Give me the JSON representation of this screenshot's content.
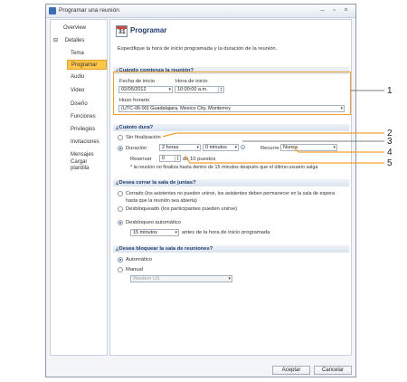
{
  "window": {
    "title": "Programar una reunión"
  },
  "sidebar": {
    "items": [
      {
        "label": "Overview"
      },
      {
        "label": "Detalles"
      },
      {
        "label": "Tema"
      },
      {
        "label": "Programar"
      },
      {
        "label": "Audio"
      },
      {
        "label": "Video"
      },
      {
        "label": "Diseño"
      },
      {
        "label": "Funciones"
      },
      {
        "label": "Privilegios"
      },
      {
        "label": "Invitaciones"
      },
      {
        "label": "Mensajes"
      },
      {
        "label": "Cargar plantilla"
      }
    ],
    "expander": "⊟"
  },
  "page": {
    "icon_number": "31",
    "title": "Programar",
    "description": "Especifique la hora de inicio programada y la duración de la reunión."
  },
  "start": {
    "header": "¿Cuándo comienza la reunión?",
    "date_label": "Fecha de inicio",
    "date_value": "02/05/2012",
    "time_label": "Hora de inicio",
    "time_value": "10:00:00 a.m.",
    "tz_label": "Huso horario",
    "tz_value": "(UTC-06:00) Guadalajara, Mexico City, Monterrey"
  },
  "duration": {
    "header": "¿Cuánto dura?",
    "no_end_label": "Sin finalización",
    "duration_label": "Duración",
    "hours_value": "2 horas",
    "minutes_value": "0 minutos",
    "recurs_label": "Recurre",
    "recurs_value": "Nunca",
    "reserve_label": "Reservar",
    "reserve_value": "0",
    "reserve_suffix": "de 10 puestos",
    "note": "* la reunión no finaliza hasta dentro de 15 minutos después que el último usuario salga"
  },
  "room_close": {
    "header": "¿Desea cerrar la sala de juntas?",
    "opt_closed": "Cerrado (los asistentes no pueden unirse, los asistentes deben permanecer en la sala de espera",
    "opt_closed_2": "hasta que la reunión sea abierta)",
    "opt_unlocked": "Desbloqueado (los participantes pueden unirse)",
    "opt_auto": "Desbloqueo automático",
    "minutes_value": "15 minutos",
    "minutes_suffix": "antes de la hora de inicio programada"
  },
  "room_lock": {
    "header": "¿Desea bloquear la sala de reuniones?",
    "opt_auto": "Automático",
    "opt_manual": "Manual",
    "manual_value": "Western US"
  },
  "buttons": {
    "ok": "Aceptar",
    "cancel": "Cancelar"
  },
  "callouts": [
    "1",
    "2",
    "3",
    "4",
    "5"
  ],
  "colors": {
    "highlight": "#ffc64a",
    "callout": "#f0a030",
    "header_text": "#1f3d6b"
  }
}
